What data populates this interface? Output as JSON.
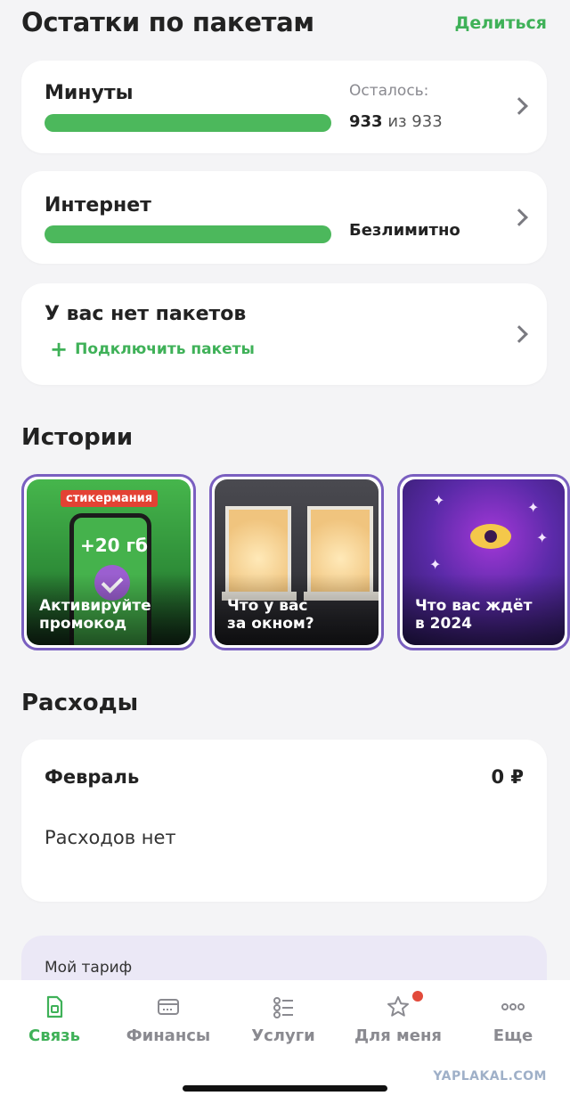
{
  "header": {
    "title": "Остатки по пакетам",
    "share_label": "Делиться"
  },
  "packages": {
    "minutes": {
      "title": "Минуты",
      "remaining_label": "Осталось:",
      "remaining_amount": "933",
      "remaining_of": "из 933",
      "fill_fraction": 1.0
    },
    "internet": {
      "title": "Интернет",
      "status": "Безлимитно",
      "fill_fraction": 1.0
    },
    "none": {
      "title": "У вас нет пакетов",
      "connect_label": "Подключить пакеты"
    }
  },
  "stories": {
    "title": "Истории",
    "items": [
      {
        "text": "Активируйте\nпромокод",
        "badge": "стикермания",
        "promo": "+20 гб"
      },
      {
        "text": "Что у вас\nза окном?"
      },
      {
        "text": "Что вас ждёт\nв 2024"
      }
    ]
  },
  "expenses": {
    "title": "Расходы",
    "month": "Февраль",
    "amount": "0 ₽",
    "empty_text": "Расходов нет"
  },
  "tariff": {
    "label": "Мой тариф"
  },
  "tabbar": {
    "items": [
      {
        "label": "Связь",
        "icon": "sim-card-icon",
        "active": true
      },
      {
        "label": "Финансы",
        "icon": "wallet-icon",
        "active": false
      },
      {
        "label": "Услуги",
        "icon": "services-list-icon",
        "active": false
      },
      {
        "label": "Для меня",
        "icon": "star-icon",
        "active": false,
        "has_badge": true
      },
      {
        "label": "Еще",
        "icon": "more-dots-icon",
        "active": false
      }
    ]
  },
  "watermark": "YAPLAKAL.COM",
  "colors": {
    "accent_green": "#3fb158",
    "bar_green": "#4cb85c",
    "badge_red": "#e24a3b",
    "story_border": "#7a5fc0"
  }
}
